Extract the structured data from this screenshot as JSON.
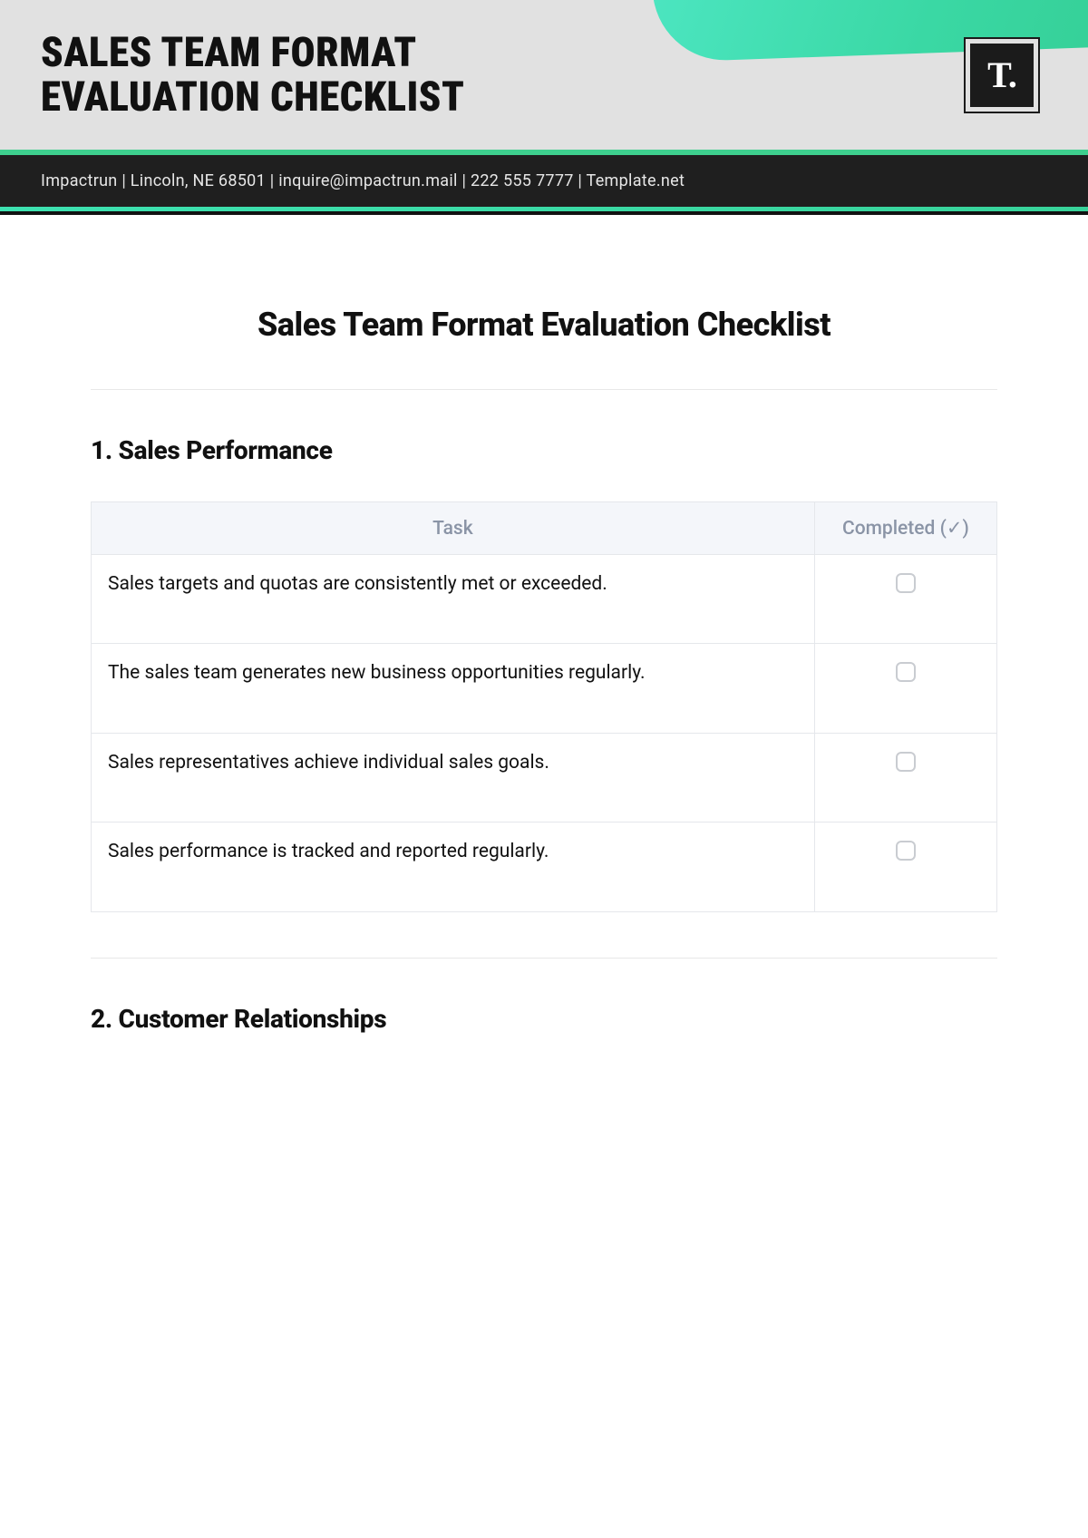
{
  "header": {
    "title_line1": "SALES TEAM FORMAT",
    "title_line2": "EVALUATION CHECKLIST",
    "logo_text": "T."
  },
  "info_bar": "Impactrun | Lincoln, NE 68501 | inquire@impactrun.mail | 222 555 7777 | Template.net",
  "document": {
    "title": "Sales Team Format Evaluation Checklist"
  },
  "table_headers": {
    "task": "Task",
    "completed": "Completed (✓)"
  },
  "sections": [
    {
      "heading": "1. Sales Performance",
      "rows": [
        "Sales targets and quotas are consistently met or exceeded.",
        "The sales team generates new business opportunities regularly.",
        "Sales representatives achieve individual sales goals.",
        "Sales performance is tracked and reported regularly."
      ]
    },
    {
      "heading": "2. Customer Relationships",
      "rows": []
    }
  ]
}
